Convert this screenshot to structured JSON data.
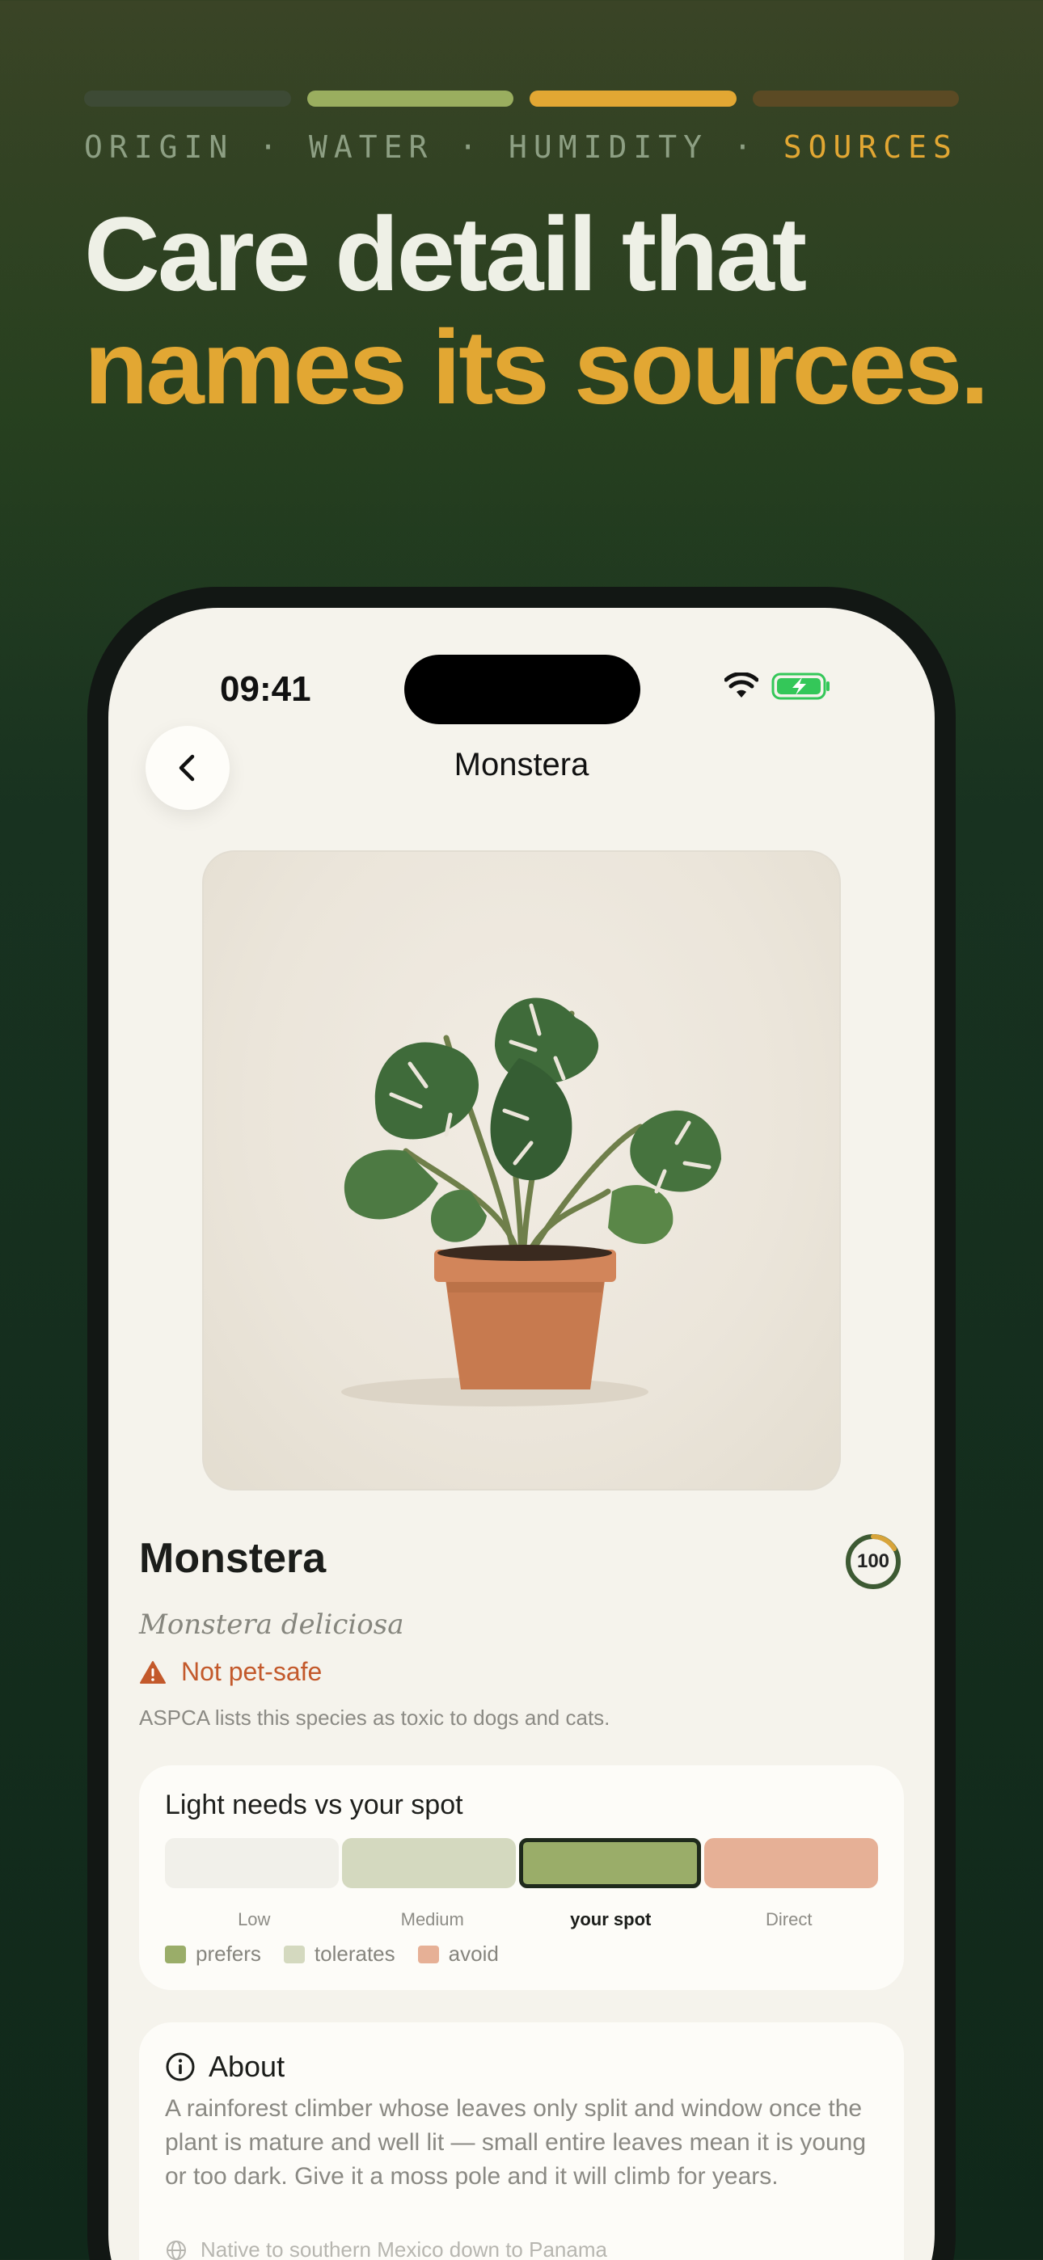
{
  "colors": {
    "accent_gold": "#e2a733",
    "segment_1": "#3d4a35",
    "segment_2": "#9aae5f",
    "segment_3": "#e2a733",
    "segment_4": "#5b4a24",
    "prefers": "#9aad69",
    "tolerates": "#d4d9bf",
    "avoid": "#e6b096",
    "low": "#f1f0ea",
    "warning": "#c3592b"
  },
  "onboarding": {
    "steps": [
      "ORIGIN",
      "WATER",
      "HUMIDITY",
      "SOURCES"
    ],
    "separator": "·",
    "active_step": 3,
    "headline_line1": "Care detail that",
    "headline_line2": "names its sources."
  },
  "status_bar": {
    "time": "09:41",
    "icons": [
      "wifi-icon",
      "battery-charging-icon"
    ]
  },
  "nav": {
    "title": "Monstera",
    "back_icon": "chevron-left-icon"
  },
  "plant": {
    "name": "Monstera",
    "latin": "Monstera deliciosa",
    "score": "100",
    "score_fraction": 1.0,
    "warning_label": "Not pet-safe",
    "warning_icon": "warning-triangle-icon",
    "warning_note": "ASPCA lists this species as toxic to dogs and cats."
  },
  "light": {
    "title": "Light needs vs your spot",
    "levels": [
      {
        "label": "Low",
        "status": "low"
      },
      {
        "label": "Medium",
        "status": "tolerates"
      },
      {
        "label": "your spot",
        "status": "prefers"
      },
      {
        "label": "Direct",
        "status": "avoid"
      }
    ],
    "your_spot_index": 2,
    "legend": [
      {
        "label": "prefers",
        "key": "prefers"
      },
      {
        "label": "tolerates",
        "key": "tolerates"
      },
      {
        "label": "avoid",
        "key": "avoid"
      }
    ]
  },
  "about": {
    "title": "About",
    "icon": "info-icon",
    "text": "A rainforest climber whose leaves only split and window once the plant is mature and well lit — small entire leaves mean it is young or too dark. Give it a moss pole and it will climb for years.",
    "native_icon": "globe-icon",
    "native": "Native to southern Mexico down to Panama"
  }
}
